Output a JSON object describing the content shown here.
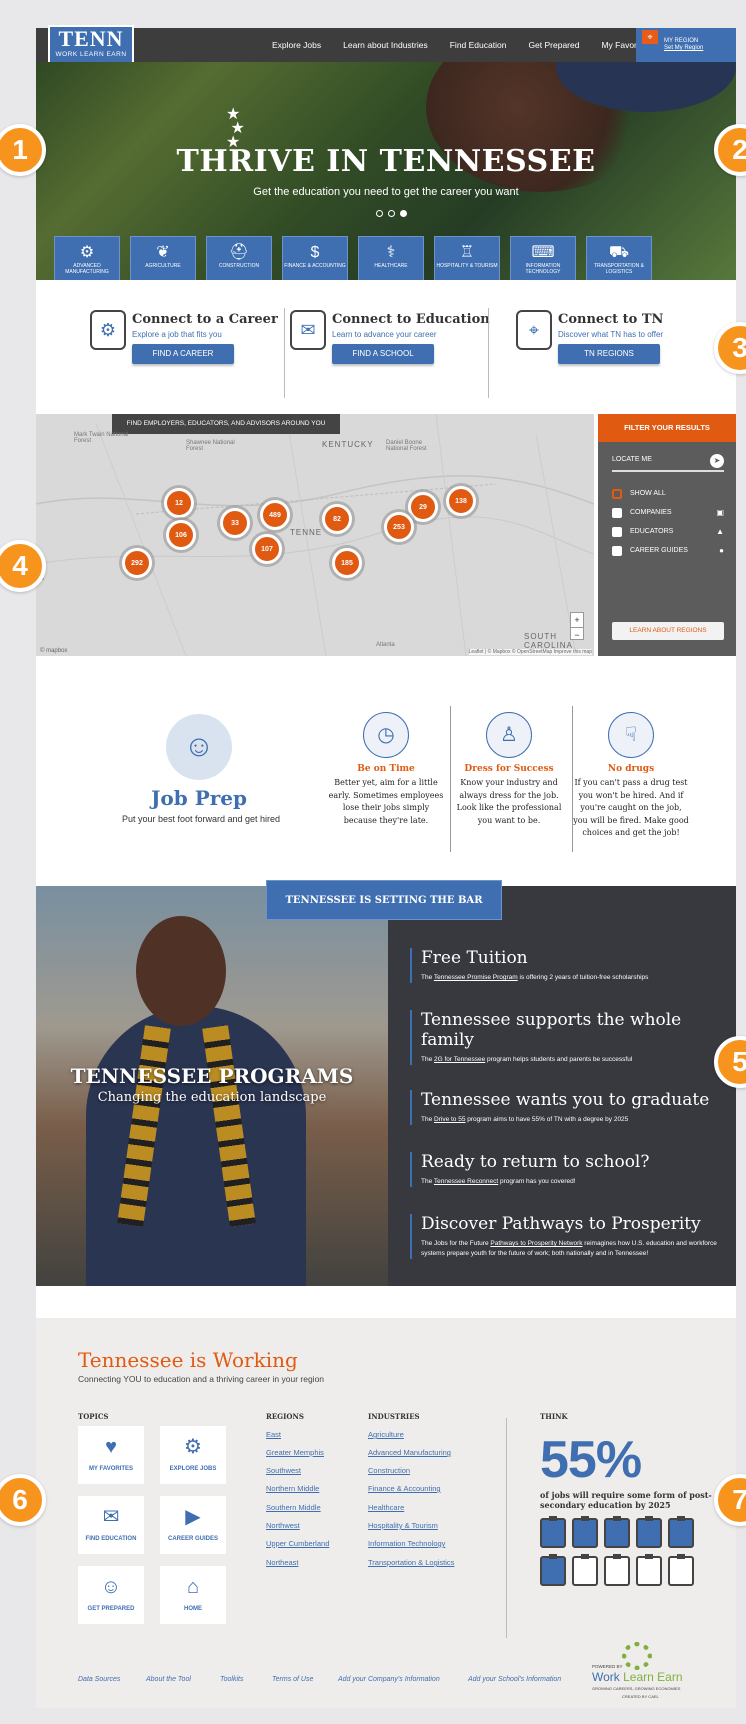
{
  "annotations": [
    "1",
    "2",
    "3",
    "4",
    "5",
    "6",
    "7"
  ],
  "nav": {
    "logo_main": "TENN",
    "logo_sub": "WORK LEARN EARN",
    "links": [
      "Explore Jobs",
      "Learn about Industries",
      "Find Education",
      "Get Prepared",
      "My Favorites"
    ],
    "region_label": "MY REGION",
    "region_link": "Set My Region"
  },
  "hero": {
    "title": "THRIVE IN TENNESSEE",
    "subtitle": "Get the education you need to get the career you want",
    "industries": [
      "ADVANCED MANUFACTURING",
      "AGRICULTURE",
      "CONSTRUCTION",
      "FINANCE & ACCOUNTING",
      "HEALTHCARE",
      "HOSPITALITY & TOURISM",
      "INFORMATION TECHNOLOGY",
      "TRANSPORTATION & LOGISTICS"
    ]
  },
  "connect": [
    {
      "title": "Connect to a Career",
      "desc": "Explore a job that fits you",
      "button": "FIND A CAREER"
    },
    {
      "title": "Connect to Education",
      "desc": "Learn to advance your career",
      "button": "FIND A SCHOOL"
    },
    {
      "title": "Connect to TN",
      "desc": "Discover what TN has to offer",
      "button": "TN REGIONS"
    }
  ],
  "map": {
    "tag": "FIND EMPLOYERS, EDUCATORS, AND ADVISORS AROUND YOU",
    "labels": {
      "kentucky": "KENTUCKY",
      "tennessee": "TENNE",
      "south_carolina": "SOUTH CAROLINA",
      "mark_twain": "Mark Twain National Forest",
      "daniel_boone": "Daniel Boone National Forest",
      "shawnee": "Shawnee National Forest",
      "as": "AS",
      "atlanta": "Atlanta"
    },
    "clusters": [
      "12",
      "106",
      "33",
      "489",
      "82",
      "29",
      "138",
      "253",
      "292",
      "107",
      "185"
    ],
    "zoom_in": "+",
    "zoom_out": "−",
    "attribution": "Leaflet | © Mapbox © OpenStreetMap Improve this map",
    "mapbox": "© mapbox"
  },
  "filter": {
    "title": "FILTER YOUR RESULTS",
    "locate": "LOCATE ME",
    "options": [
      "SHOW ALL",
      "COMPANIES",
      "EDUCATORS",
      "CAREER GUIDES"
    ],
    "learn": "LEARN ABOUT REGIONS"
  },
  "jobprep": {
    "title": "Job Prep",
    "subtitle": "Put your best foot forward and get hired",
    "tips": [
      {
        "title": "Be on Time",
        "text": "Better yet, aim for a little early. Sometimes employees lose their jobs simply because they're late."
      },
      {
        "title": "Dress for Success",
        "text": "Know your industry and always dress for the job. Look like the professional you want to be."
      },
      {
        "title": "No drugs",
        "text": "If you can't pass a drug test you won't be hired. And if you're caught on the job, you will be fired. Make good choices and get the job!"
      }
    ]
  },
  "programs": {
    "tag": "TENNESSEE IS SETTING THE BAR",
    "title": "TENNESSEE PROGRAMS",
    "subtitle": "Changing the education landscape",
    "items": [
      {
        "title": "Free Tuition",
        "pre": "The ",
        "link": "Tennessee Promise Program",
        "post": " is offering 2 years of tuition-free scholarships"
      },
      {
        "title": "Tennessee supports the whole family",
        "pre": "The ",
        "link": "2G for Tennessee",
        "post": " program helps students and parents be successful"
      },
      {
        "title": "Tennessee wants you to graduate",
        "pre": "The ",
        "link": "Drive to 55",
        "post": " program aims to have 55% of TN with a degree by 2025"
      },
      {
        "title": "Ready to return to school?",
        "pre": "The ",
        "link": "Tennessee Reconnect",
        "post": " program has you covered!"
      },
      {
        "title": "Discover Pathways to Prosperity",
        "pre": "The Jobs for the Future ",
        "link": "Pathways to Prosperity Network",
        "post": " reimagines how U.S. education and workforce systems prepare youth for the future of work; both nationally and in Tennessee!"
      }
    ]
  },
  "footer": {
    "title": "Tennessee is Working",
    "subtitle": "Connecting YOU to education and a thriving career in your region",
    "topics_h": "TOPICS",
    "regions_h": "REGIONS",
    "industries_h": "INDUSTRIES",
    "think_h": "THINK",
    "topics": [
      "MY FAVORITES",
      "EXPLORE JOBS",
      "FIND EDUCATION",
      "CAREER GUIDES",
      "GET PREPARED",
      "HOME"
    ],
    "regions": [
      "East",
      "Greater Memphis",
      "Southwest",
      "Northern Middle",
      "Southern Middle",
      "Northwest",
      "Upper Cumberland",
      "Northeast"
    ],
    "industries": [
      "Agriculture",
      "Advanced Manufacturing",
      "Construction",
      "Finance & Accounting",
      "Healthcare",
      "Hospitality & Tourism",
      "Information Technology",
      "Transportation & Logistics"
    ],
    "stat": "55%",
    "stat_text": "of jobs will require some form of post-secondary education by 2025",
    "stat_filled": 6,
    "stat_total": 10,
    "bottom_links": [
      "Data Sources",
      "About the Tool",
      "Toolkits",
      "Terms of Use",
      "Add your Company's Information",
      "Add your School's Information"
    ],
    "powered": "POWERED BY",
    "brand_a": "Work ",
    "brand_b": "Learn Earn",
    "tagline": "GROWING CAREERS, GROWING ECONOMIES.",
    "created": "CREATED BY CAEL"
  }
}
